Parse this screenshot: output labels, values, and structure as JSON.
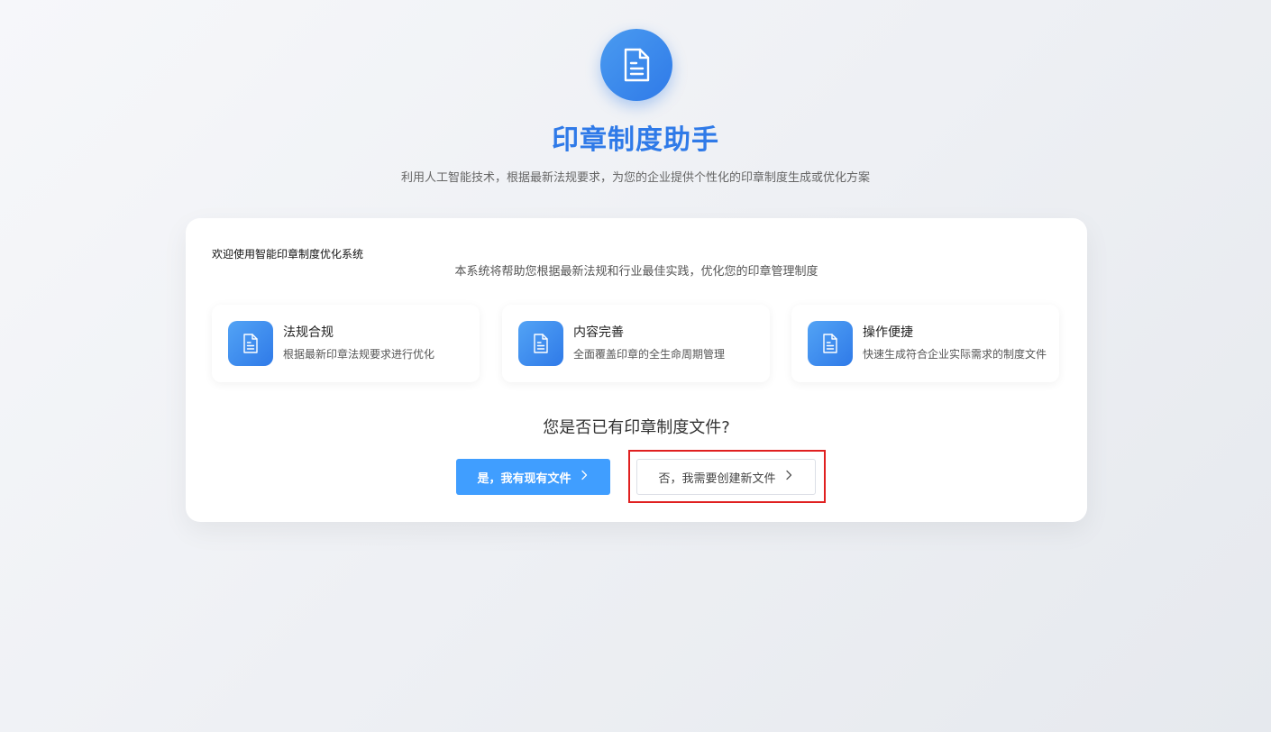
{
  "header": {
    "title": "印章制度助手",
    "subtitle": "利用人工智能技术，根据最新法规要求，为您的企业提供个性化的印章制度生成或优化方案",
    "icon": "document-icon"
  },
  "card": {
    "welcome_title": "欢迎使用智能印章制度优化系统",
    "welcome_desc": "本系统将帮助您根据最新法规和行业最佳实践，优化您的印章管理制度",
    "features": [
      {
        "title": "法规合规",
        "desc": "根据最新印章法规要求进行优化",
        "icon": "document-icon"
      },
      {
        "title": "内容完善",
        "desc": "全面覆盖印章的全生命周期管理",
        "icon": "document-icon"
      },
      {
        "title": "操作便捷",
        "desc": "快速生成符合企业实际需求的制度文件",
        "icon": "document-icon"
      }
    ],
    "question": "您是否已有印章制度文件?",
    "yes_button": "是，我有现有文件",
    "no_button": "否，我需要创建新文件"
  },
  "colors": {
    "brand": "#2f7ae8",
    "primary_button": "#409eff",
    "highlight": "#e02020"
  }
}
